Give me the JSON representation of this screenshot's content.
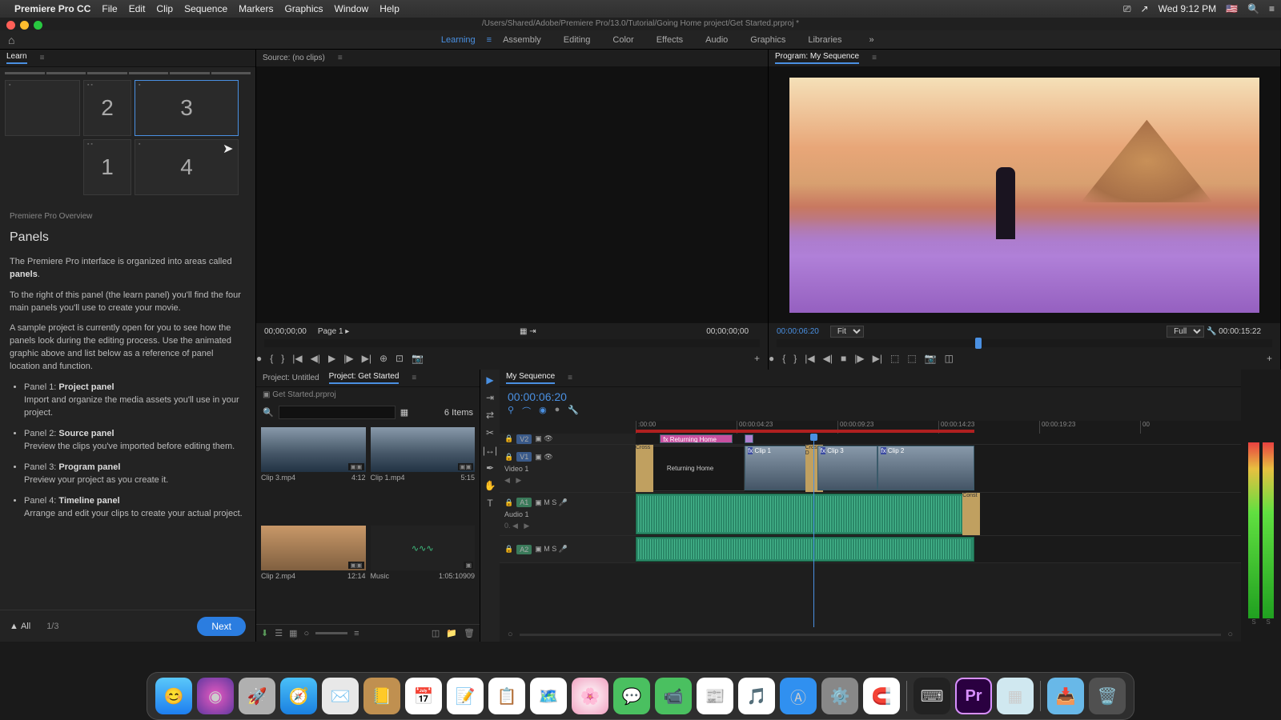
{
  "menubar": {
    "app": "Premiere Pro CC",
    "items": [
      "File",
      "Edit",
      "Clip",
      "Sequence",
      "Markers",
      "Graphics",
      "Window",
      "Help"
    ],
    "clock": "Wed 9:12 PM",
    "flag": "🇺🇸"
  },
  "titlebar": "/Users/Shared/Adobe/Premiere Pro/13.0/Tutorial/Going Home project/Get Started.prproj *",
  "workspaces": [
    "Learning",
    "Assembly",
    "Editing",
    "Color",
    "Effects",
    "Audio",
    "Graphics",
    "Libraries"
  ],
  "workspace_active": 0,
  "learn": {
    "tab": "Learn",
    "diagram": {
      "n2": "2",
      "n3": "3",
      "n4": "1",
      "n5": "4"
    },
    "crumb": "Premiere Pro Overview",
    "title": "Panels",
    "p1": "The Premiere Pro interface is organized into areas called",
    "p1b": "panels",
    "p2": "To the right of this panel (the learn panel) you'll find the four main panels you'll use to create your movie.",
    "p3": "A sample project is currently open for you to see how the panels look during the editing process. Use the animated graphic above and list below as a reference of panel location and function.",
    "items": [
      {
        "pre": "Panel 1: ",
        "b": "Project panel",
        "d": "Import and organize the media assets you'll use in your project."
      },
      {
        "pre": "Panel 2: ",
        "b": "Source panel",
        "d": "Preview the clips you've imported before editing them."
      },
      {
        "pre": "Panel 3: ",
        "b": "Program panel",
        "d": "Preview your project as you create it."
      },
      {
        "pre": "Panel 4: ",
        "b": "Timeline panel",
        "d": "Arrange and edit your clips to create your actual project."
      }
    ],
    "all": "All",
    "page": "1/3",
    "next": "Next"
  },
  "source": {
    "tab": "Source: (no clips)",
    "tc_left": "00;00;00;00",
    "page": "Page 1",
    "tc_right": "00;00;00;00"
  },
  "program": {
    "tab": "Program: My Sequence",
    "tc_left": "00:00:06:20",
    "fit": "Fit",
    "full": "Full",
    "tc_right": "00:00:15:22"
  },
  "project": {
    "tab1": "Project: Untitled",
    "tab2": "Project: Get Started",
    "file": "Get Started.prproj",
    "items_label": "6 Items",
    "search_placeholder": "",
    "clips": [
      {
        "name": "Clip 3.mp4",
        "dur": "4:12"
      },
      {
        "name": "Clip 1.mp4",
        "dur": "5:15"
      },
      {
        "name": "Clip 2.mp4",
        "dur": "12:14"
      },
      {
        "name": "Music",
        "dur": "1:05:10909"
      }
    ]
  },
  "timeline": {
    "tab": "My Sequence",
    "tc": "00:00:06:20",
    "ticks": [
      ":00:00",
      "00:00:04:23",
      "00:00:09:23",
      "00:00:14:23",
      "00:00:19:23",
      "00"
    ],
    "tracks": {
      "v2": {
        "label": "V2"
      },
      "v1": {
        "label": "V1",
        "name": "Video 1"
      },
      "a1": {
        "label": "A1",
        "name": "Audio 1"
      },
      "a2": {
        "label": "A2"
      }
    },
    "clips": {
      "title": "Returning Home",
      "blk": "Returning Home",
      "c1": "Clip 1",
      "c3": "Clip 3",
      "c2": "Clip 2",
      "cross": "Cross",
      "crossd": "Cross D",
      "const": "Const"
    }
  },
  "meters": {
    "s": "S"
  },
  "dock_apps": [
    "finder",
    "siri",
    "launchpad",
    "safari",
    "mail",
    "contacts",
    "calendar",
    "notes",
    "reminders",
    "maps",
    "photos",
    "messages",
    "facetime",
    "news",
    "music",
    "appstore",
    "settings",
    "magnet",
    "",
    "terminal",
    "premiere",
    "plugin",
    "",
    "downloads",
    "trash"
  ]
}
